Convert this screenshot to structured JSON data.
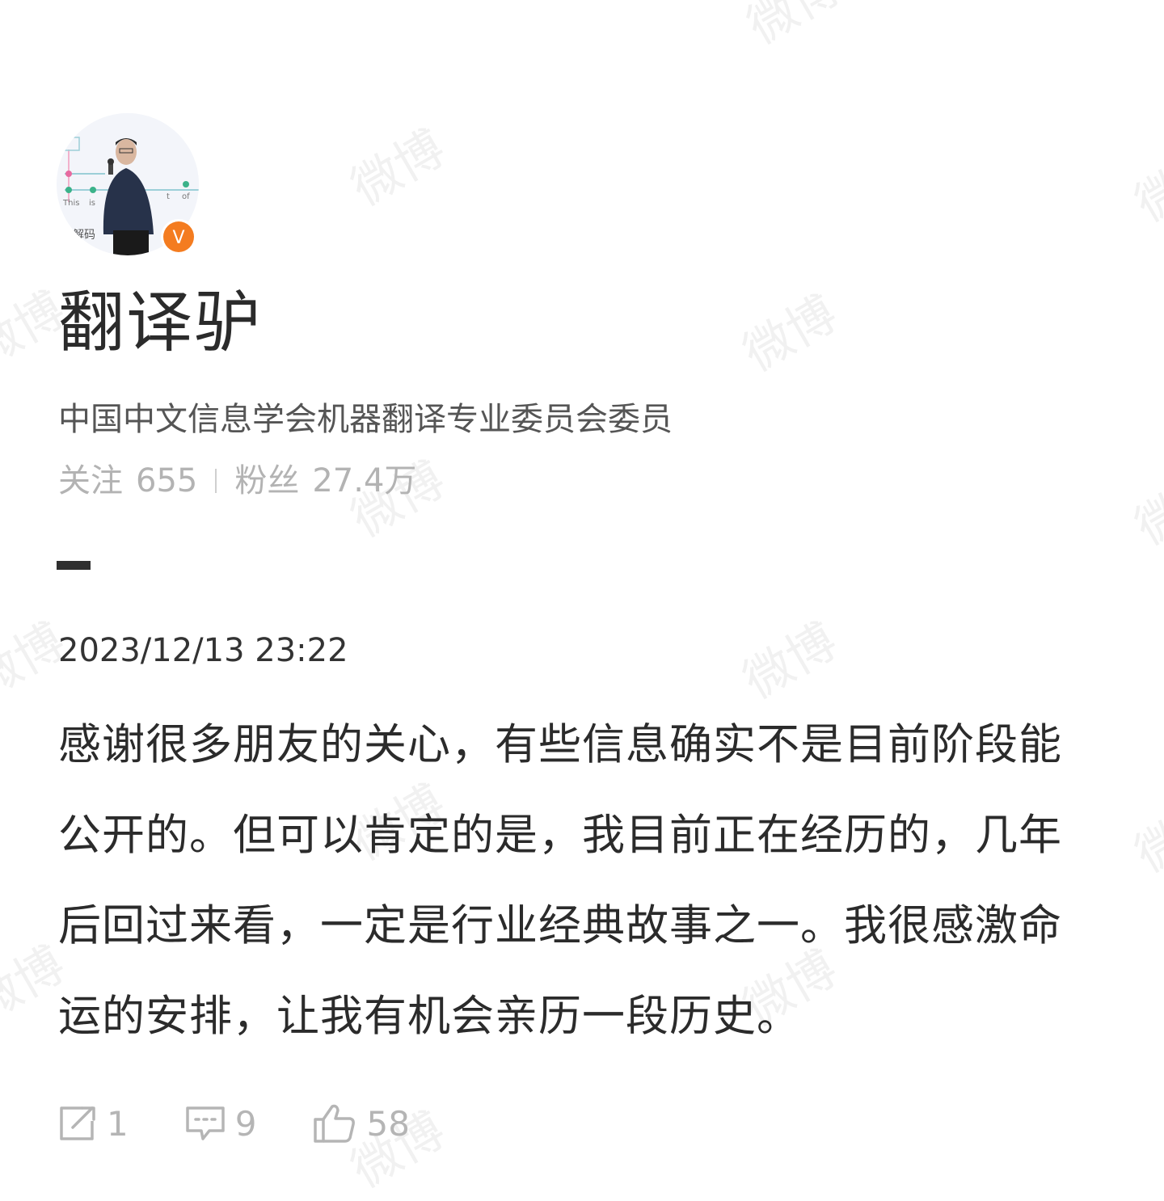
{
  "profile": {
    "name": "翻译驴",
    "bio": "中国中文信息学会机器翻译专业委员会委员",
    "following_label": "关注",
    "following_count": "655",
    "followers_label": "粉丝",
    "followers_count": "27.4万",
    "verified_badge_letter": "V",
    "avatar_slide_words": [
      "This",
      "is",
      "t",
      "of"
    ],
    "avatar_caption": "解码"
  },
  "post": {
    "timestamp": "2023/12/13 23:22",
    "text": "感谢很多朋友的关心，有些信息确实不是目前阶段能公开的。但可以肯定的是，我目前正在经历的，几年后回过来看，一定是行业经典故事之一。我很感激命运的安排，让我有机会亲历一段历史。"
  },
  "actions": {
    "repost_count": "1",
    "comment_count": "9",
    "like_count": "58"
  },
  "watermark": "微博",
  "colors": {
    "badge": "#f47c20",
    "text_primary": "#2b2b2b",
    "text_muted": "#b3b3b3"
  },
  "icons": [
    "repost-icon",
    "comment-icon",
    "like-icon",
    "verified-icon"
  ]
}
